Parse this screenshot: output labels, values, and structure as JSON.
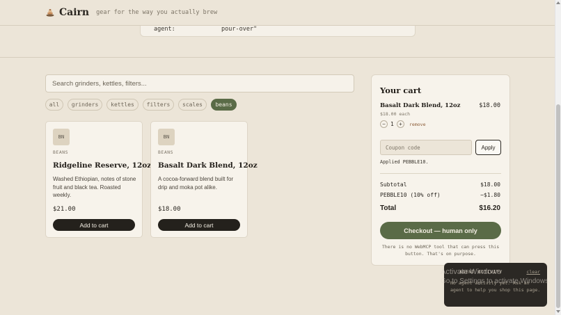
{
  "header": {
    "brand": "Cairn",
    "tagline": "gear for the way you actually brew",
    "logo_icon": "cairn-stones-icon"
  },
  "code_strip": {
    "key": "agent:",
    "value": "pour-over\""
  },
  "search": {
    "placeholder": "Search grinders, kettles, filters..."
  },
  "filters": [
    {
      "label": "all",
      "active": false
    },
    {
      "label": "grinders",
      "active": false
    },
    {
      "label": "kettles",
      "active": false
    },
    {
      "label": "filters",
      "active": false
    },
    {
      "label": "scales",
      "active": false
    },
    {
      "label": "beans",
      "active": true
    }
  ],
  "products": [
    {
      "badge": "BN",
      "category": "BEANS",
      "name": "Ridgeline Reserve, 12oz",
      "description": "Washed Ethiopian, notes of stone fruit and black tea. Roasted weekly.",
      "price": "$21.00",
      "button": "Add to cart"
    },
    {
      "badge": "BN",
      "category": "BEANS",
      "name": "Basalt Dark Blend, 12oz",
      "description": "A cocoa-forward blend built for drip and moka pot alike.",
      "price": "$18.00",
      "button": "Add to cart"
    }
  ],
  "cart": {
    "title": "Your cart",
    "item": {
      "name": "Basalt Dark Blend, 12oz",
      "price": "$18.00",
      "each": "$18.00 each",
      "quantity": "1",
      "minus": "−",
      "plus": "+",
      "remove": "remove"
    },
    "coupon_placeholder": "Coupon code",
    "apply": "Apply",
    "applied": "Applied PEBBLE10.",
    "subtotal_label": "Subtotal",
    "subtotal": "$18.00",
    "discount_label": "PEBBLE10 (10% off)",
    "discount": "−$1.80",
    "total_label": "Total",
    "total": "$16.20",
    "checkout": "Checkout — human only",
    "note": "There is no WebMCP tool that can press this button. That's on purpose."
  },
  "agent_panel": {
    "title": "AGENT ACTIVITY",
    "clear": "clear",
    "body": "No agent activity yet. Ask an agent to help you shop this page."
  },
  "watermark": {
    "line1": "Activate Windows",
    "line2": "Go to Settings to activate Windows."
  },
  "colors": {
    "background": "#ece5d8",
    "accent": "#5a6b47",
    "dark": "#24211c",
    "card": "#f7f3eb"
  }
}
